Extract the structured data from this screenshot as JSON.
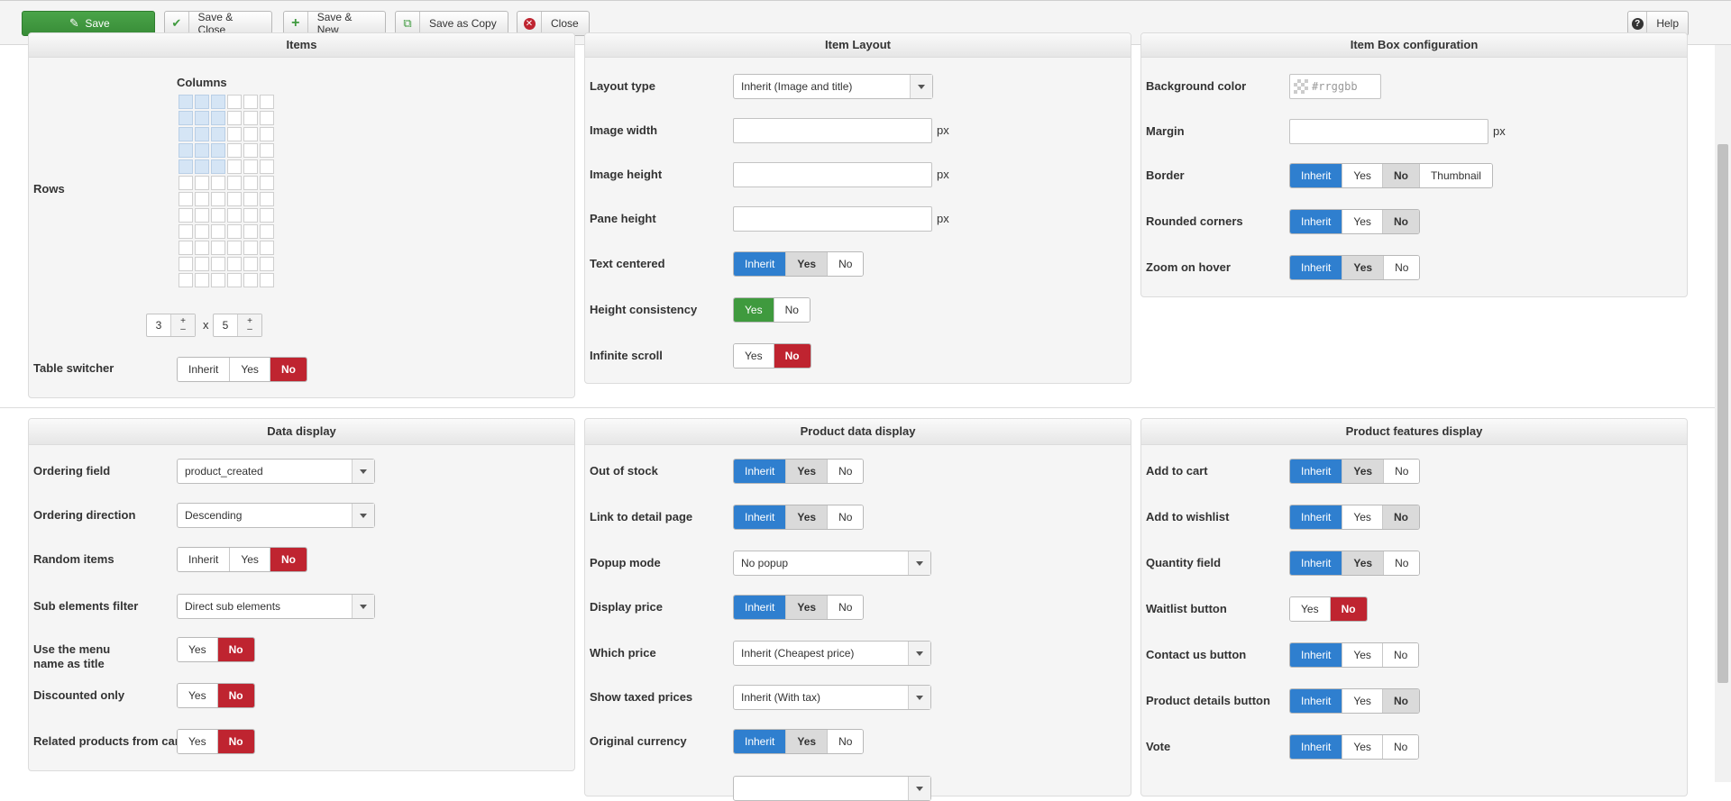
{
  "toolbar": {
    "save": "Save",
    "save_close": "Save & Close",
    "save_new": "Save & New",
    "save_copy": "Save as Copy",
    "close": "Close",
    "help": "Help"
  },
  "panel_items": {
    "title": "Items",
    "columns_label": "Columns",
    "rows_label": "Rows",
    "grid_columns": 6,
    "grid_rows": 12,
    "selected_columns": 3,
    "selected_rows": 5,
    "columns_value": "3",
    "x_sep": "x",
    "rows_value": "5",
    "plus": "+",
    "minus": "–",
    "table_switcher": {
      "label": "Table switcher",
      "options": [
        "Inherit",
        "Yes",
        "No"
      ]
    }
  },
  "panel_layout": {
    "title": "Item Layout",
    "layout_type": {
      "label": "Layout type",
      "value": "Inherit (Image and title)"
    },
    "image_width": {
      "label": "Image width",
      "unit": "px"
    },
    "image_height": {
      "label": "Image height",
      "unit": "px"
    },
    "pane_height": {
      "label": "Pane height",
      "unit": "px"
    },
    "text_centered": {
      "label": "Text centered",
      "options": [
        "Inherit",
        "Yes",
        "No"
      ]
    },
    "height_consistency": {
      "label": "Height consistency",
      "options": [
        "Yes",
        "No"
      ]
    },
    "infinite_scroll": {
      "label": "Infinite scroll",
      "options": [
        "Yes",
        "No"
      ]
    }
  },
  "panel_box": {
    "title": "Item Box configuration",
    "background_color": {
      "label": "Background color",
      "placeholder": "#rrggbb"
    },
    "margin": {
      "label": "Margin",
      "unit": "px"
    },
    "border": {
      "label": "Border",
      "options": [
        "Inherit",
        "Yes",
        "No",
        "Thumbnail"
      ]
    },
    "rounded_corners": {
      "label": "Rounded corners",
      "options": [
        "Inherit",
        "Yes",
        "No"
      ]
    },
    "zoom_on_hover": {
      "label": "Zoom on hover",
      "options": [
        "Inherit",
        "Yes",
        "No"
      ]
    }
  },
  "panel_data": {
    "title": "Data display",
    "ordering_field": {
      "label": "Ordering field",
      "value": "product_created"
    },
    "ordering_direction": {
      "label": "Ordering direction",
      "value": "Descending"
    },
    "random_items": {
      "label": "Random items",
      "options": [
        "Inherit",
        "Yes",
        "No"
      ]
    },
    "sub_elements_filter": {
      "label": "Sub elements filter",
      "value": "Direct sub elements"
    },
    "use_menu_name_line1": "Use the menu",
    "use_menu_name_line2": "name as title",
    "use_menu_name_options": [
      "Yes",
      "No"
    ],
    "discounted_only": {
      "label": "Discounted only",
      "options": [
        "Yes",
        "No"
      ]
    },
    "related_products": {
      "label": "Related products from car",
      "options": [
        "Yes",
        "No"
      ]
    }
  },
  "panel_product": {
    "title": "Product data display",
    "out_of_stock": {
      "label": "Out of stock",
      "options": [
        "Inherit",
        "Yes",
        "No"
      ]
    },
    "link_detail": {
      "label": "Link to detail page",
      "options": [
        "Inherit",
        "Yes",
        "No"
      ]
    },
    "popup_mode": {
      "label": "Popup mode",
      "value": "No popup"
    },
    "display_price": {
      "label": "Display price",
      "options": [
        "Inherit",
        "Yes",
        "No"
      ]
    },
    "which_price": {
      "label": "Which price",
      "value": "Inherit (Cheapest price)"
    },
    "show_taxed": {
      "label": "Show taxed prices",
      "value": "Inherit (With tax)"
    },
    "original_currency": {
      "label": "Original currency",
      "options": [
        "Inherit",
        "Yes",
        "No"
      ]
    }
  },
  "panel_features": {
    "title": "Product features display",
    "add_to_cart": {
      "label": "Add to cart",
      "options": [
        "Inherit",
        "Yes",
        "No"
      ]
    },
    "add_to_wishlist": {
      "label": "Add to wishlist",
      "options": [
        "Inherit",
        "Yes",
        "No"
      ]
    },
    "quantity_field": {
      "label": "Quantity field",
      "options": [
        "Inherit",
        "Yes",
        "No"
      ]
    },
    "waitlist_button": {
      "label": "Waitlist button",
      "options": [
        "Yes",
        "No"
      ]
    },
    "contact_us": {
      "label": "Contact us button",
      "options": [
        "Inherit",
        "Yes",
        "No"
      ]
    },
    "product_details": {
      "label": "Product details button",
      "options": [
        "Inherit",
        "Yes",
        "No"
      ]
    },
    "vote": {
      "label": "Vote",
      "options": [
        "Inherit",
        "Yes",
        "No"
      ]
    }
  },
  "colors": {
    "primary_blue": "#2f7fcf",
    "danger_red": "#bf2430",
    "success_green": "#3f9a3e",
    "neutral_grey": "#dadada"
  }
}
